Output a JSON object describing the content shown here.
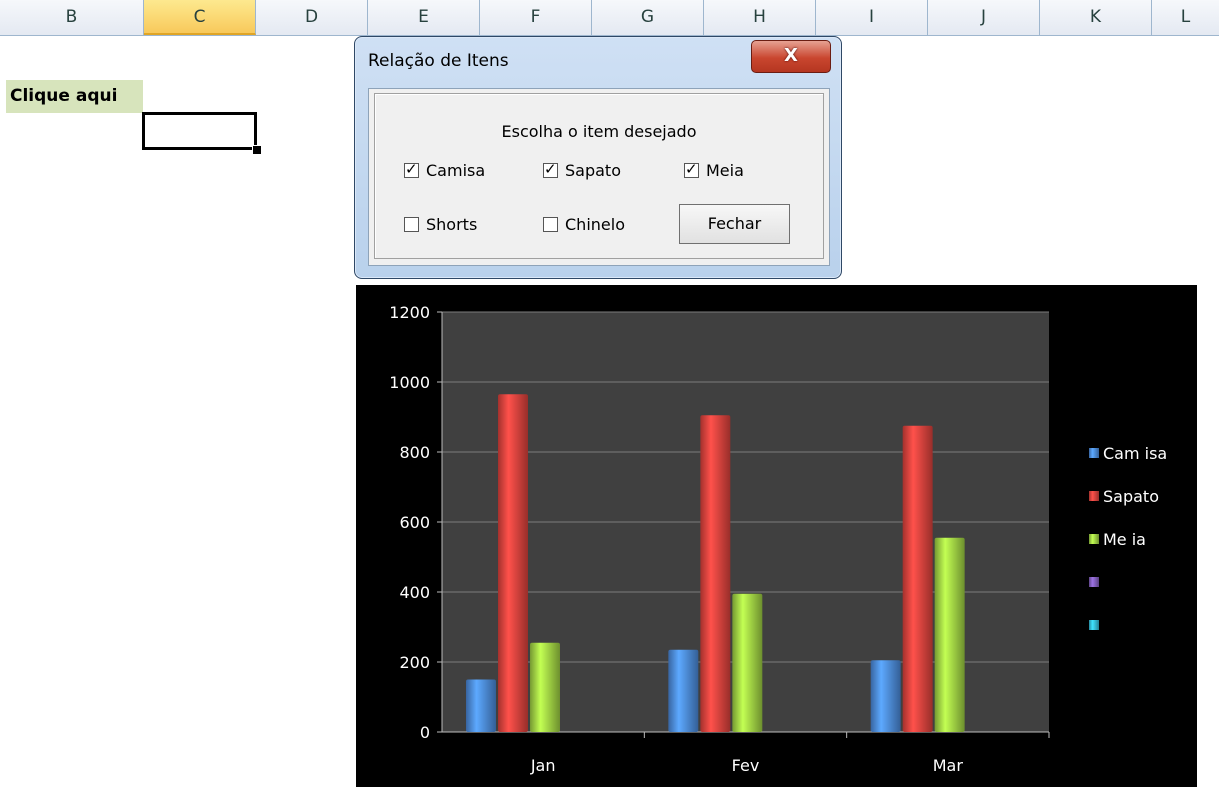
{
  "sheet": {
    "columns": [
      "B",
      "C",
      "D",
      "E",
      "F",
      "G",
      "H",
      "I",
      "J",
      "K",
      "L"
    ],
    "active_column": "C",
    "cell_label": "Clique aqui"
  },
  "dialog": {
    "title": "Relação de Itens",
    "close_label": "X",
    "prompt": "Escolha o item desejado",
    "checkboxes": [
      {
        "label": "Camisa",
        "checked": true
      },
      {
        "label": "Sapato",
        "checked": true
      },
      {
        "label": "Meia",
        "checked": true
      },
      {
        "label": "Shorts",
        "checked": false
      },
      {
        "label": "Chinelo",
        "checked": false
      }
    ],
    "close_button": "Fechar"
  },
  "chart_data": {
    "type": "bar",
    "categories": [
      "Jan",
      "Fev",
      "Mar"
    ],
    "series": [
      {
        "name": "Cam isa",
        "values": [
          150,
          235,
          205
        ],
        "color": "#4a87d6"
      },
      {
        "name": "Sapato",
        "values": [
          965,
          905,
          875
        ],
        "color": "#d9413c"
      },
      {
        "name": "Me ia",
        "values": [
          255,
          395,
          555
        ],
        "color": "#9ccc42"
      },
      {
        "name": "",
        "values": [],
        "color": "#7e5cb6"
      },
      {
        "name": "",
        "values": [],
        "color": "#33b6d4"
      }
    ],
    "ylim": [
      0,
      1200
    ],
    "yticks": [
      "0",
      "200",
      "400",
      "600",
      "800",
      "1000",
      "1200"
    ],
    "grid": true,
    "legend": "right",
    "plot_background": "#404040"
  }
}
